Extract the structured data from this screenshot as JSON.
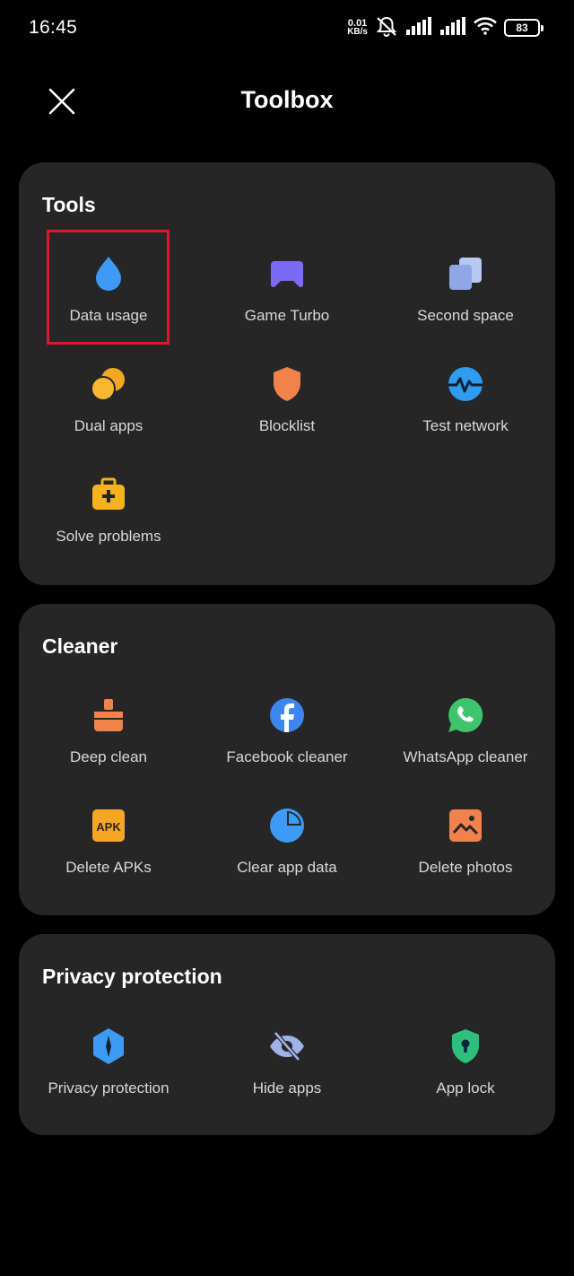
{
  "status_bar": {
    "time": "16:45",
    "speed_value": "0.01",
    "speed_unit": "KB/s",
    "battery": "83"
  },
  "header": {
    "title": "Toolbox"
  },
  "sections": {
    "tools": {
      "title": "Tools",
      "items": [
        {
          "label": "Data usage",
          "icon": "drop-icon",
          "color": "#3d9bf5"
        },
        {
          "label": "Game Turbo",
          "icon": "gamepad-icon",
          "color": "#7a6cf2"
        },
        {
          "label": "Second space",
          "icon": "stacked-squares-icon",
          "color": "#9eb3ea"
        },
        {
          "label": "Dual apps",
          "icon": "dual-circles-icon",
          "color": "#f5a623"
        },
        {
          "label": "Blocklist",
          "icon": "shield-icon",
          "color": "#f2824b"
        },
        {
          "label": "Test network",
          "icon": "pulse-icon",
          "color": "#2f9cf0"
        },
        {
          "label": "Solve problems",
          "icon": "toolbox-icon",
          "color": "#f5b21d"
        }
      ]
    },
    "cleaner": {
      "title": "Cleaner",
      "items": [
        {
          "label": "Deep clean",
          "icon": "broom-icon",
          "color": "#f2824b"
        },
        {
          "label": "Facebook cleaner",
          "icon": "facebook-icon",
          "color": "#3d86f0"
        },
        {
          "label": "WhatsApp cleaner",
          "icon": "whatsapp-icon",
          "color": "#3ec46d"
        },
        {
          "label": "Delete APKs",
          "icon": "apk-icon",
          "color": "#f5a623",
          "badge_text": "APK"
        },
        {
          "label": "Clear app data",
          "icon": "pie-chart-icon",
          "color": "#3d9bf5"
        },
        {
          "label": "Delete photos",
          "icon": "photo-icon",
          "color": "#f2824b"
        }
      ]
    },
    "privacy": {
      "title": "Privacy protection",
      "items": [
        {
          "label": "Privacy protection",
          "icon": "privacy-hexagon-icon",
          "color": "#3d9bf5"
        },
        {
          "label": "Hide apps",
          "icon": "eye-slash-icon",
          "color": "#9eb3ea"
        },
        {
          "label": "App lock",
          "icon": "lock-shield-icon",
          "color": "#2fbf7d"
        }
      ]
    }
  },
  "highlight_color": "#e0162b"
}
